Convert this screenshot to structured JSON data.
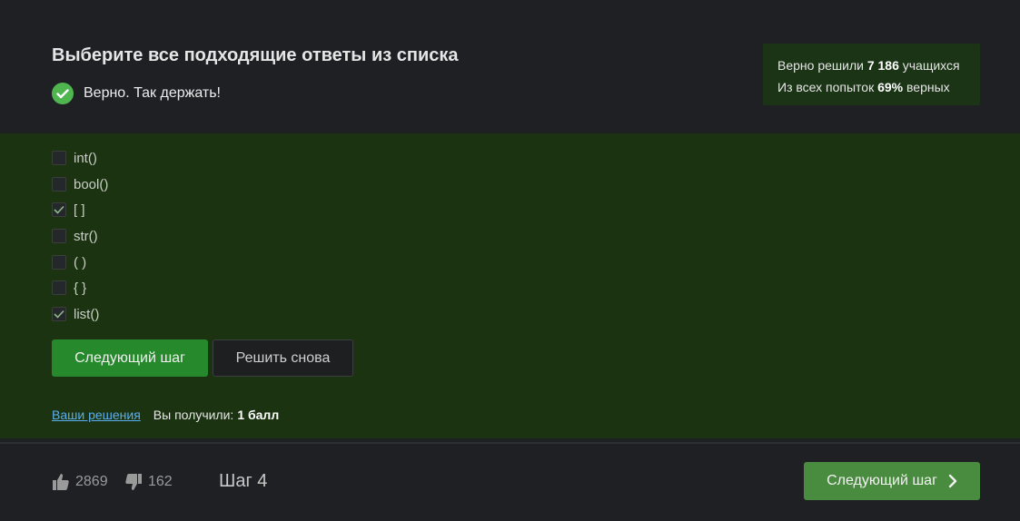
{
  "question": {
    "title": "Выберите все подходящие ответы из списка",
    "verdict": "Верно. Так держать!"
  },
  "stats": {
    "line1_prefix": "Верно решили",
    "line1_count": "7 186",
    "line1_suffix": "учащихся",
    "line2_prefix": "Из всех попыток",
    "line2_percent": "69%",
    "line2_suffix": "верных"
  },
  "options": [
    {
      "label": "int()",
      "checked": false
    },
    {
      "label": "bool()",
      "checked": false
    },
    {
      "label": "[ ]",
      "checked": true
    },
    {
      "label": "str()",
      "checked": false
    },
    {
      "label": "( )",
      "checked": false
    },
    {
      "label": "{ }",
      "checked": false
    },
    {
      "label": "list()",
      "checked": true
    }
  ],
  "buttons": {
    "next_step": "Следующий шаг",
    "retry": "Решить снова"
  },
  "result": {
    "solutions_link": "Ваши решения",
    "got_label": "Вы получили:",
    "got_value": "1 балл"
  },
  "footer": {
    "likes": "2869",
    "dislikes": "162",
    "step": "Шаг 4",
    "next_step": "Следующий шаг"
  },
  "colors": {
    "accent_green": "#268a2c",
    "answer_bg": "#1b3311",
    "link": "#5aaef0"
  }
}
